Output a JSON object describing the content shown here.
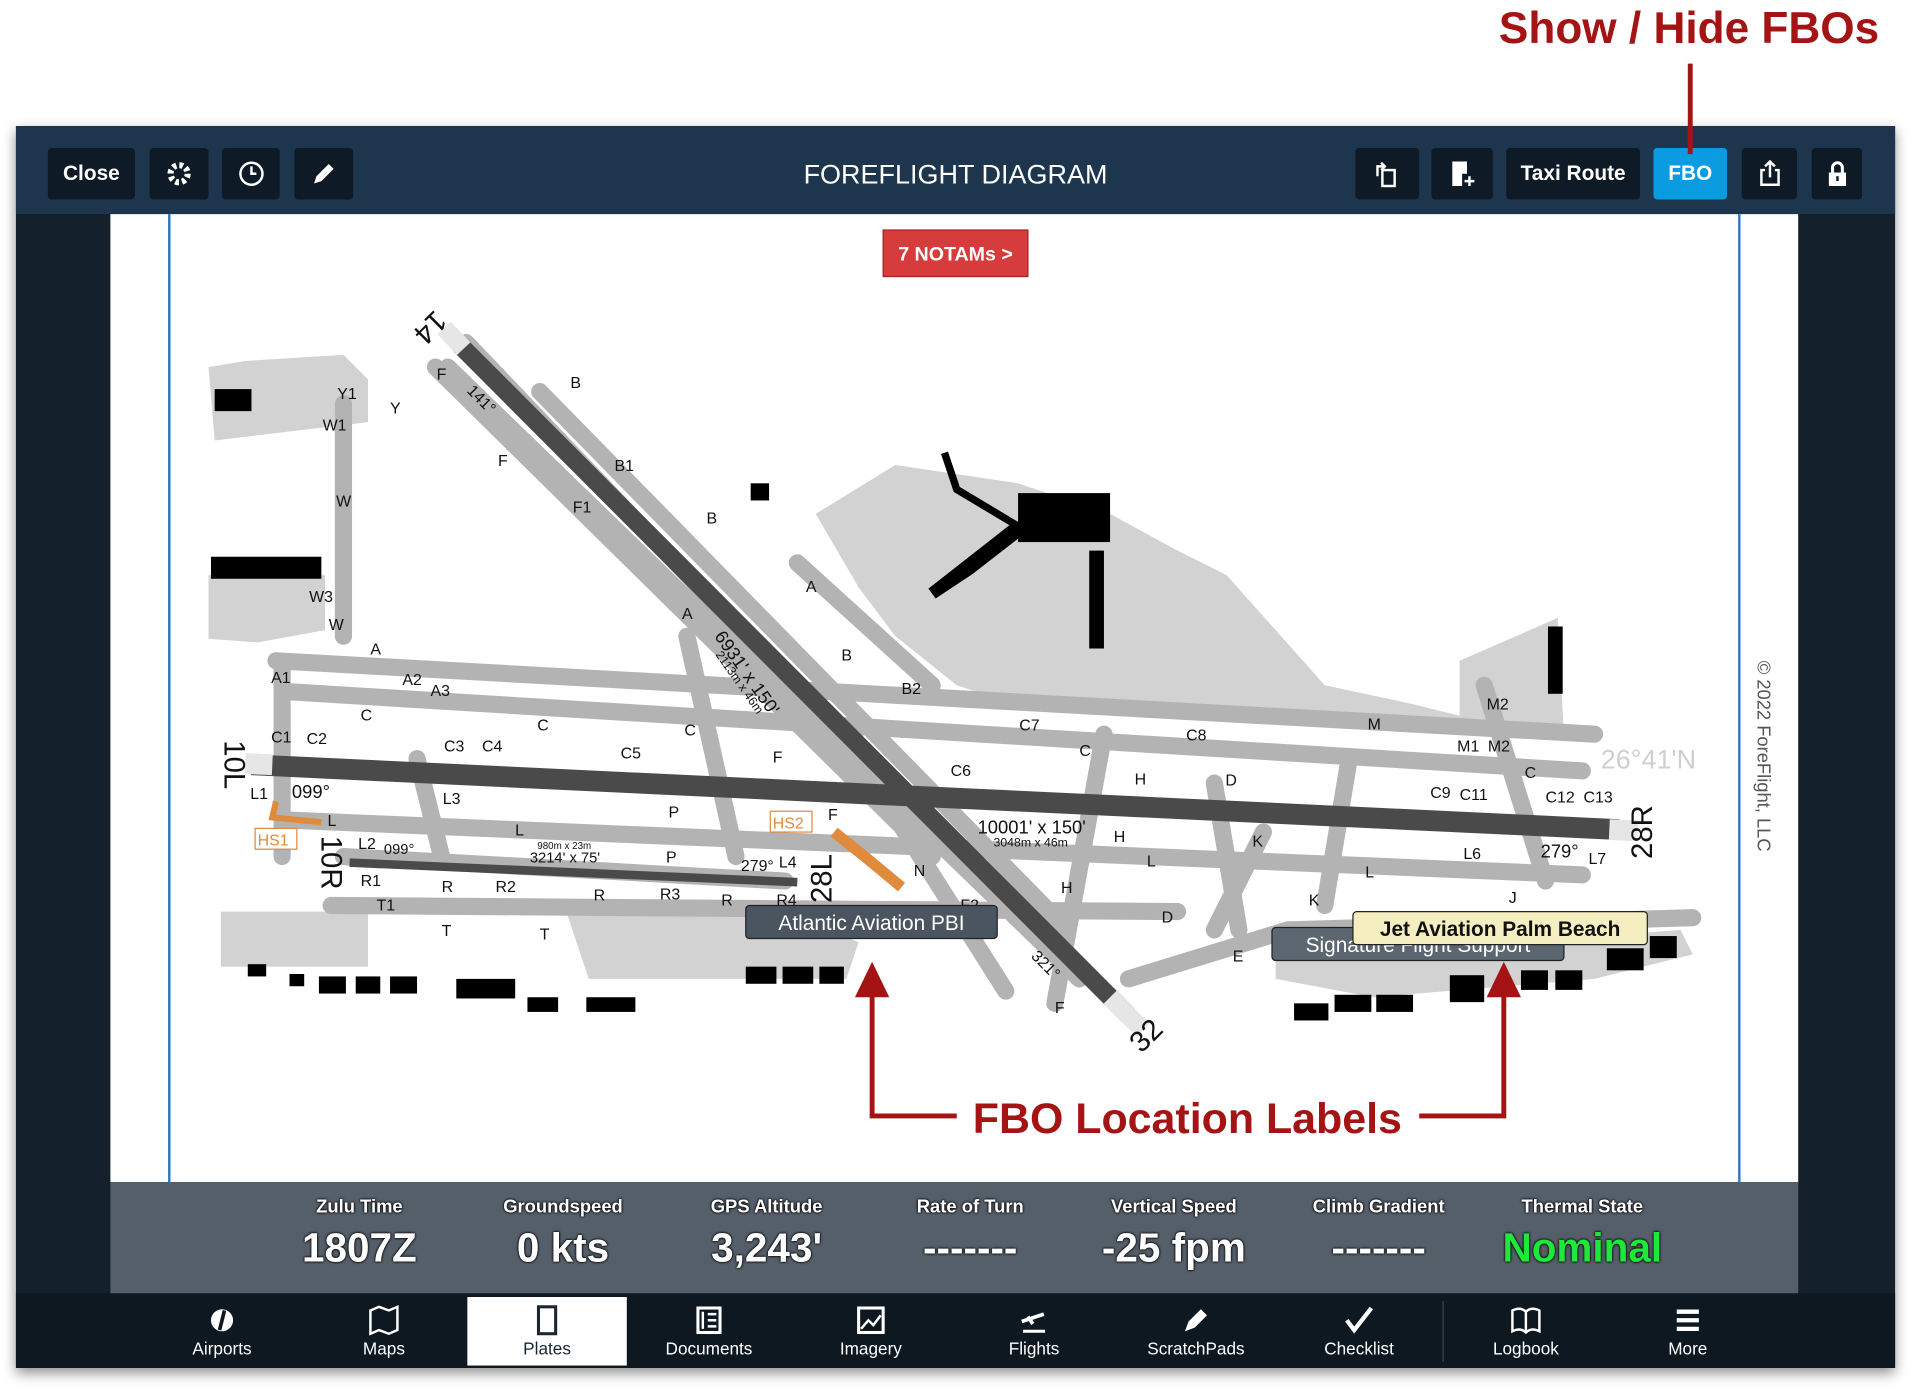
{
  "annotations": {
    "top": "Show / Hide FBOs",
    "bottom": "FBO Location Labels",
    "color": "#a51414"
  },
  "toolbar": {
    "close": "Close",
    "title": "FOREFLIGHT DIAGRAM",
    "taxi_route": "Taxi Route",
    "fbo": "FBO",
    "fbo_color": "#0a9be0",
    "icons": [
      "gear-icon",
      "clock-icon",
      "pencil-icon",
      "rotate-icon",
      "add-page-icon",
      "share-icon",
      "lock-icon"
    ]
  },
  "diagram": {
    "notams": "7 NOTAMs >",
    "copyright": "© 2022 ForeFlight, LLC",
    "latitude": "26°41'N",
    "runway_ends": [
      "14",
      "32",
      "10L",
      "28R",
      "10R",
      "28L"
    ],
    "runway_info": [
      "141°",
      "321°",
      "099°",
      "279°",
      "099°",
      "279°",
      "6931' x 150'",
      "2113m x 46m",
      "10001' x 150'",
      "3048m x 46m",
      "3214' x 75'",
      "980m x 23m"
    ],
    "hotspots": [
      "HS1",
      "HS2"
    ],
    "taxiways": [
      "Y1",
      "W1",
      "Y",
      "F",
      "B",
      "F",
      "B1",
      "F1",
      "B",
      "W",
      "A",
      "A",
      "B",
      "W3",
      "W",
      "A",
      "A1",
      "A2",
      "A3",
      "C",
      "C",
      "C",
      "F",
      "B2",
      "C1",
      "C2",
      "C3",
      "C4",
      "C5",
      "C6",
      "C7",
      "C",
      "C8",
      "M",
      "M2",
      "M1",
      "M2",
      "C",
      "C9",
      "C11",
      "C12",
      "C13",
      "L1",
      "L3",
      "L",
      "P",
      "F",
      "H",
      "D",
      "K",
      "L6",
      "L7",
      "L2",
      "L",
      "P",
      "L4",
      "R1",
      "R",
      "R2",
      "R",
      "R3",
      "R",
      "R4",
      "F2",
      "T1",
      "T",
      "T",
      "N",
      "H",
      "D",
      "E",
      "J",
      "K",
      "L",
      "L",
      "H",
      "F"
    ],
    "fbos": [
      {
        "name": "Atlantic Aviation PBI"
      },
      {
        "name": "Signature Flight Support"
      },
      {
        "name": "Jet Aviation Palm Beach"
      }
    ]
  },
  "infobar": [
    {
      "label": "Zulu Time",
      "value": "1807Z"
    },
    {
      "label": "Groundspeed",
      "value": "0 kts"
    },
    {
      "label": "GPS Altitude",
      "value": "3,243'"
    },
    {
      "label": "Rate of Turn",
      "value": "-------"
    },
    {
      "label": "Vertical Speed",
      "value": "-25 fpm"
    },
    {
      "label": "Climb Gradient",
      "value": "-------"
    },
    {
      "label": "Thermal State",
      "value": "Nominal",
      "color": "#1ee83a"
    }
  ],
  "tabs": [
    {
      "label": "Airports",
      "icon": "airports-icon"
    },
    {
      "label": "Maps",
      "icon": "maps-icon"
    },
    {
      "label": "Plates",
      "icon": "plates-icon",
      "selected": true
    },
    {
      "label": "Documents",
      "icon": "documents-icon"
    },
    {
      "label": "Imagery",
      "icon": "imagery-icon"
    },
    {
      "label": "Flights",
      "icon": "flights-icon"
    },
    {
      "label": "ScratchPads",
      "icon": "scratchpads-icon"
    },
    {
      "label": "Checklist",
      "icon": "checklist-icon"
    },
    {
      "label": "Logbook",
      "icon": "logbook-icon"
    },
    {
      "label": "More",
      "icon": "more-icon"
    }
  ]
}
